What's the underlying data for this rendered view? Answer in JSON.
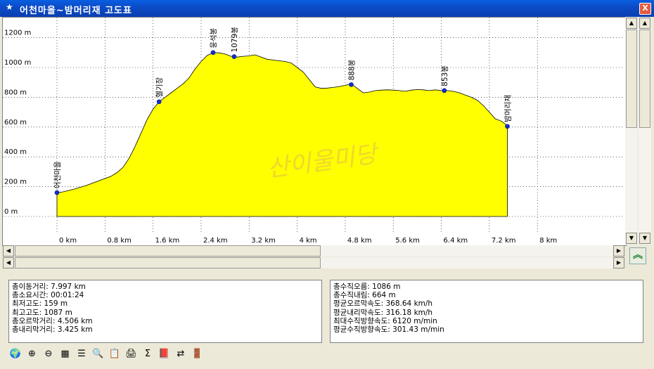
{
  "window": {
    "title": "어천마을~밤머리재 고도표",
    "close_label": "X"
  },
  "chart_data": {
    "type": "area",
    "xlabel": "",
    "ylabel": "",
    "x_ticks": [
      "0 km",
      "0.8 km",
      "1.6 km",
      "2.4 km",
      "3.2 km",
      "4 km",
      "4.8 km",
      "5.6 km",
      "6.4 km",
      "7.2 km",
      "8 km"
    ],
    "y_ticks": [
      "0 m",
      "200 m",
      "400 m",
      "600 m",
      "800 m",
      "1000 m",
      "1200 m"
    ],
    "xlim": [
      0,
      8
    ],
    "ylim": [
      0,
      1300
    ],
    "grid": true,
    "fill_color": "#ffff00",
    "line_color": "#000000",
    "profile": [
      [
        0.0,
        160
      ],
      [
        0.1,
        165
      ],
      [
        0.3,
        185
      ],
      [
        0.5,
        210
      ],
      [
        0.7,
        240
      ],
      [
        0.9,
        270
      ],
      [
        1.0,
        295
      ],
      [
        1.1,
        330
      ],
      [
        1.2,
        390
      ],
      [
        1.3,
        470
      ],
      [
        1.4,
        560
      ],
      [
        1.5,
        650
      ],
      [
        1.6,
        720
      ],
      [
        1.7,
        770
      ],
      [
        1.8,
        800
      ],
      [
        1.9,
        830
      ],
      [
        2.0,
        860
      ],
      [
        2.1,
        890
      ],
      [
        2.2,
        930
      ],
      [
        2.3,
        990
      ],
      [
        2.4,
        1040
      ],
      [
        2.5,
        1080
      ],
      [
        2.6,
        1100
      ],
      [
        2.7,
        1098
      ],
      [
        2.8,
        1090
      ],
      [
        2.9,
        1075
      ],
      [
        3.0,
        1070
      ],
      [
        3.1,
        1075
      ],
      [
        3.2,
        1078
      ],
      [
        3.3,
        1085
      ],
      [
        3.4,
        1070
      ],
      [
        3.5,
        1055
      ],
      [
        3.6,
        1050
      ],
      [
        3.7,
        1045
      ],
      [
        3.8,
        1040
      ],
      [
        3.9,
        1030
      ],
      [
        4.0,
        1000
      ],
      [
        4.1,
        970
      ],
      [
        4.2,
        920
      ],
      [
        4.3,
        870
      ],
      [
        4.4,
        860
      ],
      [
        4.5,
        862
      ],
      [
        4.6,
        866
      ],
      [
        4.7,
        872
      ],
      [
        4.8,
        880
      ],
      [
        4.9,
        890
      ],
      [
        5.0,
        860
      ],
      [
        5.1,
        830
      ],
      [
        5.2,
        835
      ],
      [
        5.3,
        845
      ],
      [
        5.4,
        848
      ],
      [
        5.5,
        850
      ],
      [
        5.6,
        848
      ],
      [
        5.7,
        845
      ],
      [
        5.8,
        840
      ],
      [
        5.9,
        848
      ],
      [
        6.0,
        852
      ],
      [
        6.1,
        850
      ],
      [
        6.2,
        845
      ],
      [
        6.3,
        850
      ],
      [
        6.4,
        845
      ],
      [
        6.5,
        845
      ],
      [
        6.6,
        840
      ],
      [
        6.7,
        830
      ],
      [
        6.8,
        815
      ],
      [
        6.9,
        800
      ],
      [
        7.0,
        780
      ],
      [
        7.1,
        745
      ],
      [
        7.2,
        700
      ],
      [
        7.3,
        655
      ],
      [
        7.4,
        640
      ],
      [
        7.5,
        610
      ]
    ],
    "points": [
      {
        "label": "어천마을",
        "x": 0.0,
        "y": 160
      },
      {
        "label": "헬기장",
        "x": 1.7,
        "y": 770
      },
      {
        "label": "웅석봉",
        "x": 2.6,
        "y": 1100
      },
      {
        "label": "1079봉",
        "x": 2.95,
        "y": 1073
      },
      {
        "label": "888봉",
        "x": 4.9,
        "y": 885
      },
      {
        "label": "853봉",
        "x": 6.45,
        "y": 845
      },
      {
        "label": "밤머리재",
        "x": 7.5,
        "y": 605
      }
    ],
    "watermark": "산이울미당"
  },
  "stats_left": [
    "총이동거리: 7.997 km",
    "총소요시간: 00:01:24",
    "최저고도: 159 m",
    "최고고도: 1087 m",
    "총오르막거리: 4.506 km",
    "총내리막거리: 3.425 km"
  ],
  "stats_right": [
    "총수직오름: 1086 m",
    "총수직내림: 664 m",
    "평균오르막속도: 368.64 km/h",
    "평균내리막속도: 316.18 km/h",
    "최대수직방향속도: 6120 m/min",
    "평균수직방향속도: 301.43 m/min"
  ],
  "toolbar": [
    {
      "icon": "globe-icon",
      "glyph": "🌍"
    },
    {
      "icon": "zoom-in-icon",
      "glyph": "⊕"
    },
    {
      "icon": "zoom-out-icon",
      "glyph": "⊖"
    },
    {
      "icon": "grid-icon",
      "glyph": "▦"
    },
    {
      "icon": "list-icon",
      "glyph": "☰"
    },
    {
      "icon": "find-icon",
      "glyph": "🔍"
    },
    {
      "icon": "notes-icon",
      "glyph": "📋"
    },
    {
      "icon": "print-icon",
      "glyph": "🖨"
    },
    {
      "icon": "sigma-icon",
      "glyph": "Σ"
    },
    {
      "icon": "book-icon",
      "glyph": "📕"
    },
    {
      "icon": "swap-icon",
      "glyph": "⇄"
    },
    {
      "icon": "exit-icon",
      "glyph": "🚪"
    }
  ],
  "colors": {
    "title_bar": "#0a52d8",
    "chart_fill": "#ffff00",
    "point": "#1030d0",
    "grid": "#000000"
  }
}
